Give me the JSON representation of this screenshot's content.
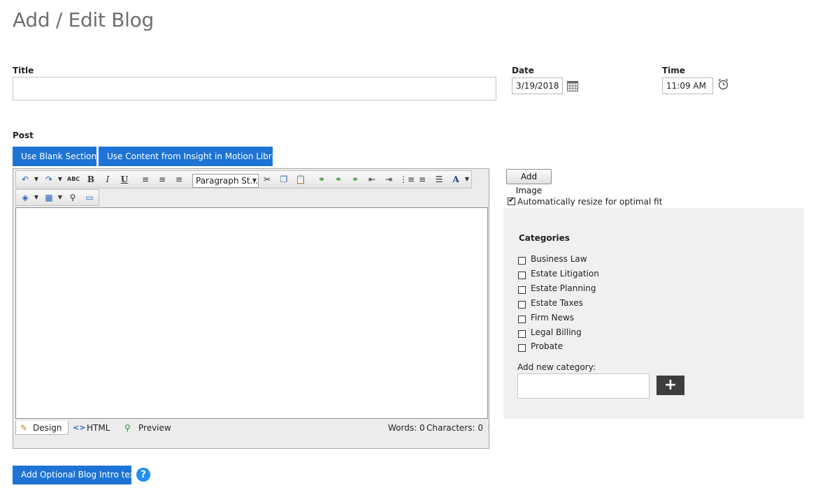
{
  "page": {
    "title": "Add / Edit Blog"
  },
  "fields": {
    "title_label": "Title",
    "title_value": "",
    "date_label": "Date",
    "date_value": "3/19/2018",
    "time_label": "Time",
    "time_value": "11:09 AM"
  },
  "post": {
    "label": "Post",
    "use_blank_label": "Use Blank Section",
    "use_library_label": "Use Content from Insight in Motion Library"
  },
  "editor": {
    "paragraph_style": "Paragraph St...",
    "toolbar_row1": [
      "undo-icon",
      "redo-icon",
      "spellcheck-icon",
      "bold-icon",
      "italic-icon",
      "underline-icon",
      "align-left-icon",
      "align-center-icon",
      "align-right-icon",
      "cut-icon",
      "copy-icon",
      "paste-icon",
      "link-icon",
      "insert-link-icon",
      "unlink-icon",
      "outdent-icon",
      "indent-icon",
      "bulleted-list-icon",
      "numbered-list-icon",
      "justify-icon",
      "font-color-icon"
    ],
    "toolbar_row2": [
      "background-color-icon",
      "table-icon",
      "find-icon",
      "insert-media-icon"
    ],
    "modes": {
      "design": "Design",
      "html": "HTML",
      "preview": "Preview"
    },
    "words": "Words: 0",
    "characters": "Characters: 0"
  },
  "image": {
    "add_image_label": "Add Image",
    "auto_resize_label": "Automatically resize for optimal fit",
    "auto_resize_checked": true
  },
  "categories": {
    "title": "Categories",
    "items": [
      {
        "label": "Business Law",
        "checked": false
      },
      {
        "label": "Estate Litigation",
        "checked": false
      },
      {
        "label": "Estate Planning",
        "checked": false
      },
      {
        "label": "Estate Taxes",
        "checked": false
      },
      {
        "label": "Firm News",
        "checked": false
      },
      {
        "label": "Legal Billing",
        "checked": false
      },
      {
        "label": "Probate",
        "checked": false
      }
    ],
    "add_new_label": "Add new category:",
    "add_new_value": ""
  },
  "footer": {
    "intro_button_label": "Add Optional Blog Intro text"
  },
  "colors": {
    "accent_blue": "#1d74d6",
    "help_blue": "#1d8ff0",
    "panel_bg": "#f0f0f0",
    "plus_btn": "#3d3d3d"
  }
}
